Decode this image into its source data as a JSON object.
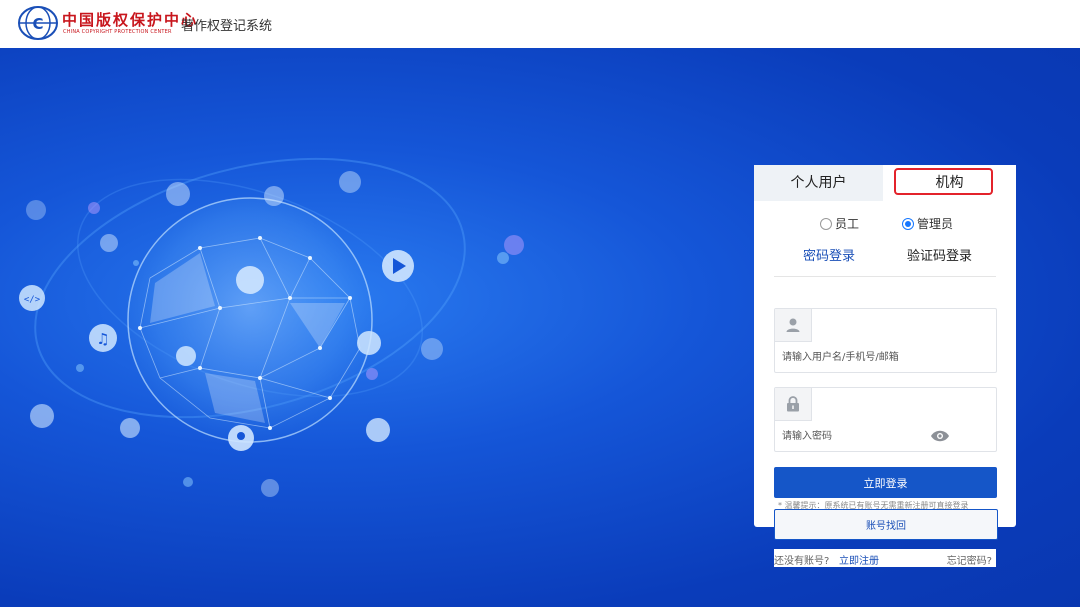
{
  "header": {
    "org_name_cn": "中国版权保护中心",
    "org_name_en": "CHINA COPYRIGHT PROTECTION CENTER",
    "system_title": "著作权登记系统"
  },
  "login": {
    "tabs": [
      {
        "label": "个人用户",
        "active": false
      },
      {
        "label": "机构",
        "active": true
      }
    ],
    "roles": [
      {
        "label": "员工",
        "selected": false
      },
      {
        "label": "管理员",
        "selected": true
      }
    ],
    "modes": [
      {
        "label": "密码登录",
        "active": true
      },
      {
        "label": "验证码登录",
        "active": false
      }
    ],
    "username": {
      "placeholder": "请输入用户名/手机号/邮箱",
      "value": ""
    },
    "password": {
      "placeholder": "请输入密码",
      "value": ""
    },
    "submit_label": "立即登录",
    "tip": "* 温馨提示：原系统已有账号无需重新注册可直接登录",
    "recover_label": "账号找回",
    "no_account_text": "还没有账号?",
    "register_label": "立即注册",
    "forgot_label": "忘记密码?"
  },
  "colors": {
    "primary": "#1556c8",
    "brand_red": "#c8161d",
    "highlight": "#e3232b",
    "hero_blue": "#1556d8"
  },
  "icons": [
    "user-icon",
    "lock-icon",
    "eye-icon",
    "music-icon",
    "play-icon",
    "location-icon",
    "code-icon",
    "book-icon",
    "mic-icon"
  ]
}
